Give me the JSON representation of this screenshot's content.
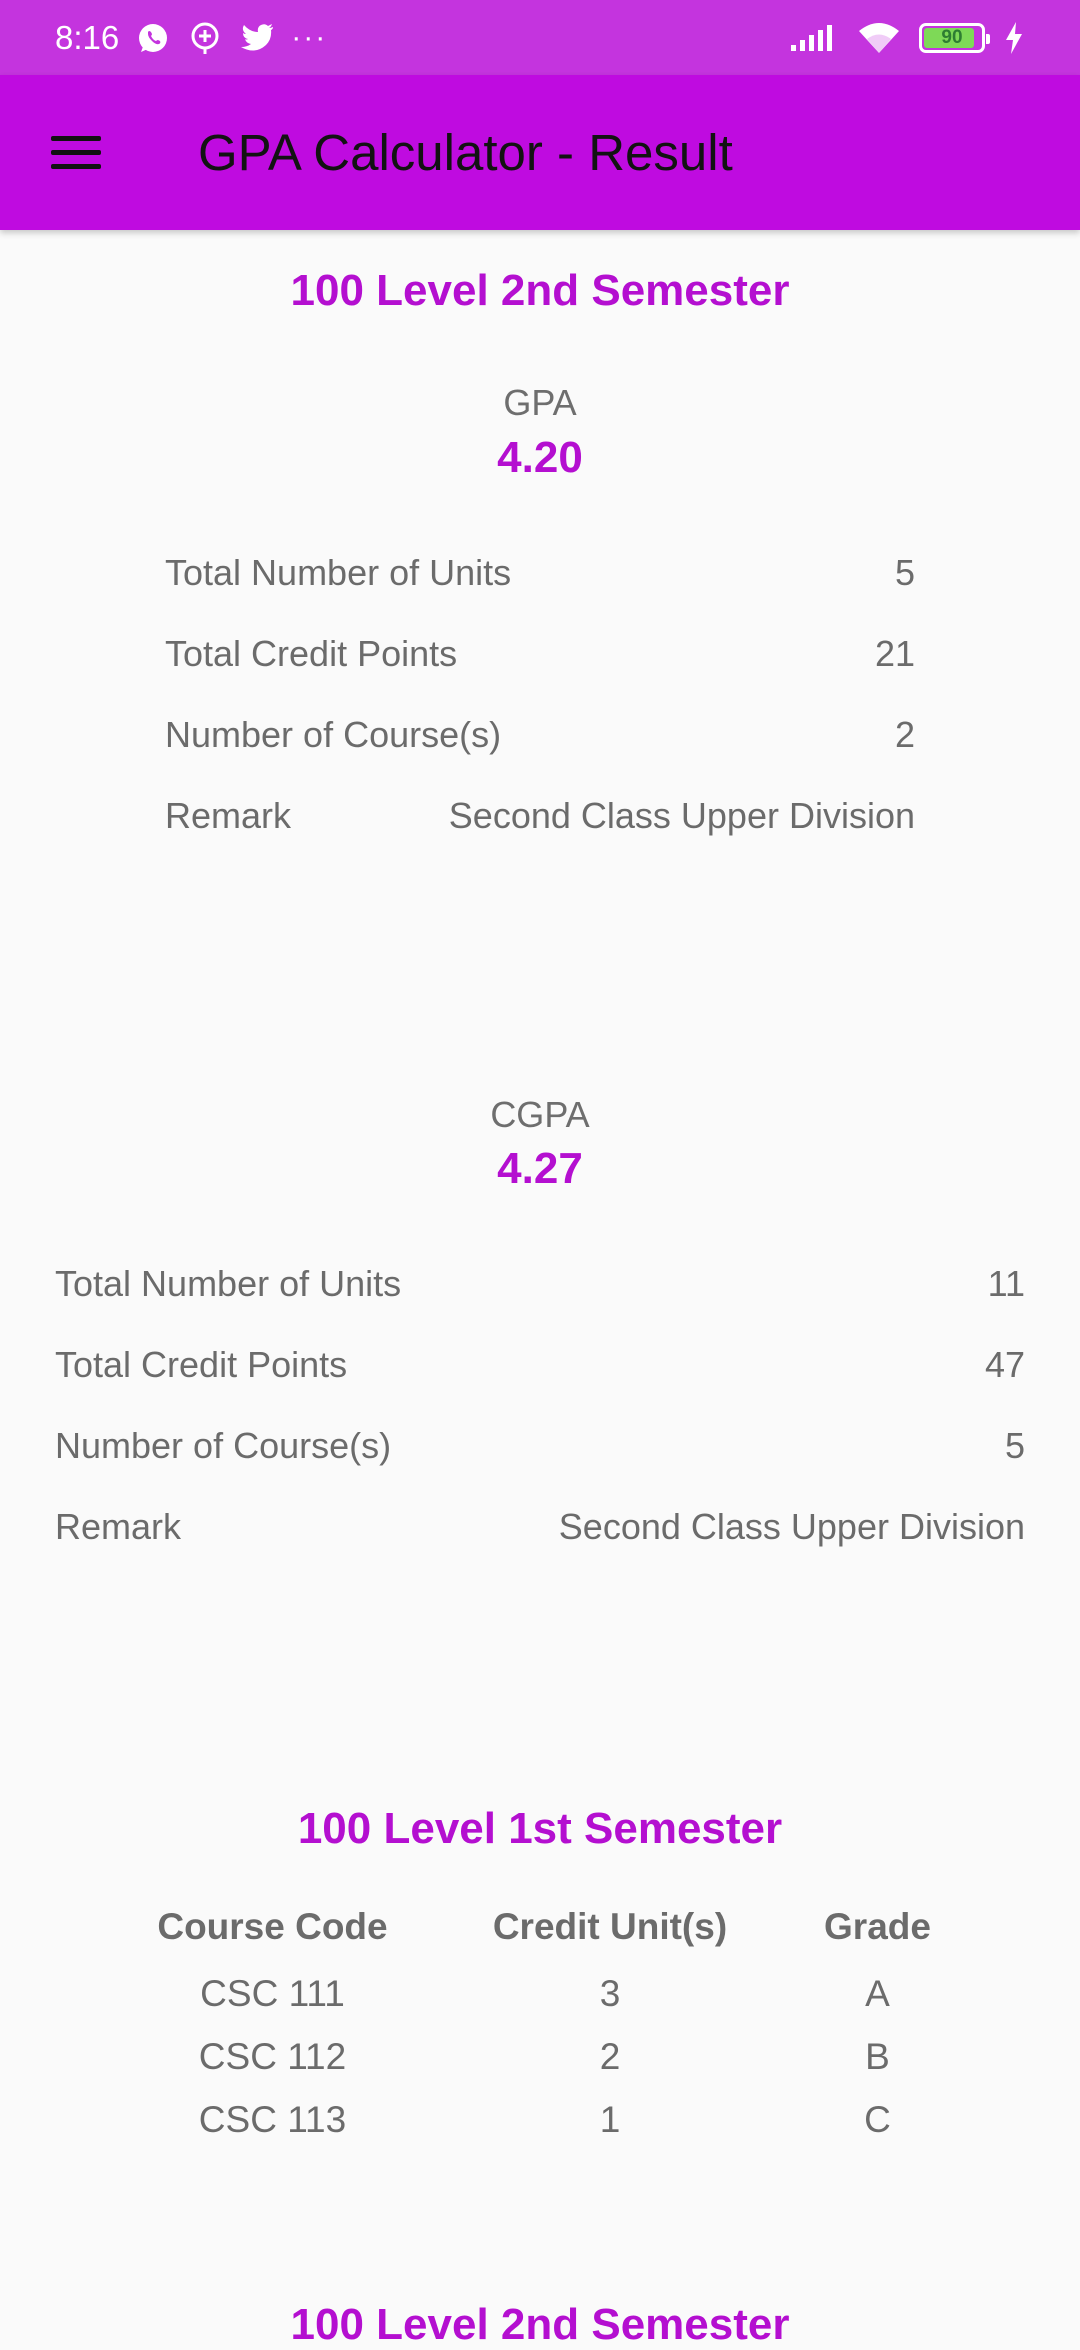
{
  "status_bar": {
    "time": "8:16",
    "more": "···",
    "battery": "90",
    "battery_level": 0.9,
    "icons": [
      "whatsapp-icon",
      "chat-plus-icon",
      "twitter-icon",
      "signal-icon",
      "wifi-icon",
      "battery-icon",
      "charging-icon"
    ]
  },
  "app_bar": {
    "title": "GPA Calculator - Result"
  },
  "gpa_section": {
    "title": "100 Level 2nd Semester",
    "label": "GPA",
    "value": "4.20",
    "rows": [
      {
        "label": "Total Number of Units",
        "value": "5"
      },
      {
        "label": "Total Credit Points",
        "value": "21"
      },
      {
        "label": "Number of Course(s)",
        "value": "2"
      },
      {
        "label": "Remark",
        "value": "Second Class Upper Division"
      }
    ]
  },
  "cgpa_section": {
    "label": "CGPA",
    "value": "4.27",
    "rows": [
      {
        "label": "Total Number of Units",
        "value": "11"
      },
      {
        "label": "Total Credit Points",
        "value": "47"
      },
      {
        "label": "Number of Course(s)",
        "value": "5"
      },
      {
        "label": "Remark",
        "value": "Second Class Upper Division"
      }
    ]
  },
  "courses_section": {
    "title": "100 Level 1st Semester",
    "headers": [
      "Course Code",
      "Credit Unit(s)",
      "Grade"
    ],
    "rows": [
      [
        "CSC 111",
        "3",
        "A"
      ],
      [
        "CSC 112",
        "2",
        "B"
      ],
      [
        "CSC 113",
        "1",
        "C"
      ]
    ]
  },
  "next_section": {
    "title": "100 Level 2nd Semester"
  },
  "colors": {
    "status_bar": "#c434de",
    "app_bar": "#bf0be0",
    "accent": "#b40fd0",
    "text": "#6b6b6b",
    "background": "#fafafa"
  }
}
